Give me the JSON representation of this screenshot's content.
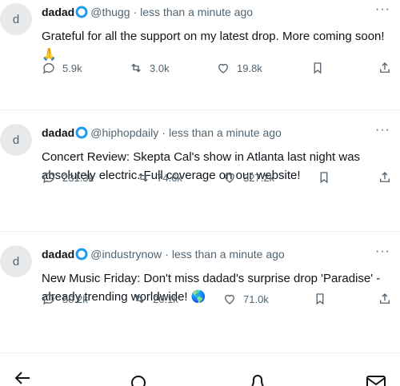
{
  "tweets": [
    {
      "avatar_letter": "d",
      "name": "dadad",
      "handle": "@thugg",
      "time": "less than a minute ago",
      "text": "Grateful for all the support on my latest drop. More coming soon! 🙏",
      "replies": "5.9k",
      "retweets": "3.0k",
      "likes": "19.8k"
    },
    {
      "avatar_letter": "d",
      "name": "dadad",
      "handle": "@hiphopdaily",
      "time": "less than a minute ago",
      "text": "Concert Review: Skepta Cal's show in Atlanta last night was absolutely electric. Full coverage on our website!",
      "replies": "231.3k",
      "retweets": "74.6k",
      "likes": "327.2k"
    },
    {
      "avatar_letter": "d",
      "name": "dadad",
      "handle": "@industrynow",
      "time": "less than a minute ago",
      "text": "New Music Friday: Don't miss dadad's surprise drop 'Paradise' - already trending worldwide! 🌎",
      "replies": "50.2k",
      "retweets": "20.1k",
      "likes": "71.0k"
    }
  ],
  "dot_separator": "·",
  "more_glyph": "···",
  "icons": {
    "verified": "verified-badge-icon",
    "reply": "reply-icon",
    "retweet": "retweet-icon",
    "like": "heart-icon",
    "bookmark": "bookmark-icon",
    "share": "share-icon",
    "back": "back-arrow-icon",
    "search": "search-icon",
    "notifications": "bell-icon",
    "messages": "mail-icon"
  },
  "colors": {
    "verified": "#1d9bf0",
    "text": "#0f1419",
    "muted": "#536471"
  }
}
